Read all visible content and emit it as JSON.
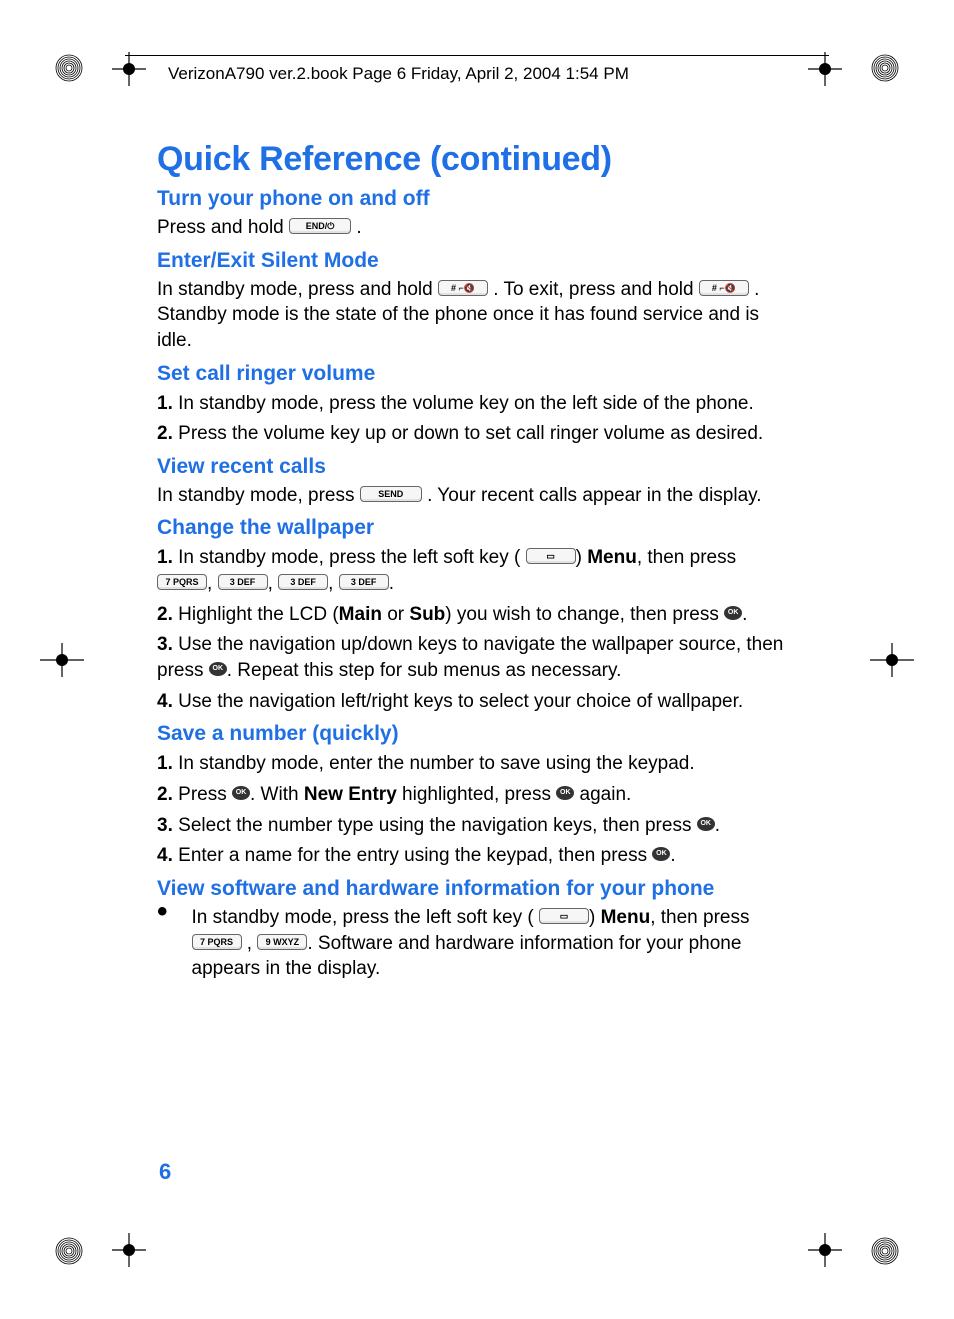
{
  "header": {
    "running_head": "VerizonA790 ver.2.book  Page 6  Friday, April 2, 2004  1:54 PM"
  },
  "page_number": "6",
  "title": "Quick Reference (continued)",
  "keys": {
    "end": "END/⏻",
    "hash": "# ⌐🔇",
    "send": "SEND",
    "softkey": "▭",
    "key7": "7 PQRS",
    "key3": "3 DEF",
    "key9": "9 WXYZ",
    "ok": "OK"
  },
  "sections": {
    "power": {
      "heading": "Turn your phone on and off",
      "body_a": "Press and hold ",
      "body_b": "."
    },
    "silent": {
      "heading": "Enter/Exit Silent Mode",
      "body_a": "In standby mode, press and hold ",
      "body_b": ". To exit, press and hold ",
      "body_c": ". Standby mode is the state of the phone once it has found service and is idle."
    },
    "ringer": {
      "heading": "Set call ringer volume",
      "step1": "In standby mode, press the volume key on the left side of the phone.",
      "step2": "Press the volume key up or down to set call ringer volume as desired."
    },
    "recent": {
      "heading": "View recent calls",
      "body_a": "In standby mode, press ",
      "body_b": ". Your recent calls appear in the display."
    },
    "wallpaper": {
      "heading": "Change the wallpaper",
      "step1_a": "In standby mode, press the left soft key (",
      "step1_b": ") ",
      "step1_menu": "Menu",
      "step1_c": ", then press ",
      "step1_d": ".",
      "step2_a": "Highlight the LCD (",
      "step2_main": "Main",
      "step2_or": " or ",
      "step2_sub": "Sub",
      "step2_b": ") you wish to change, then press ",
      "step2_c": ".",
      "step3_a": "Use the navigation up/down keys to navigate the wallpaper source, then press ",
      "step3_b": ". Repeat this step for sub menus as necessary.",
      "step4": "Use the navigation left/right keys to select your choice of wallpaper."
    },
    "save": {
      "heading": "Save a number (quickly)",
      "step1": "In standby mode, enter the number to save using the keypad.",
      "step2_a": "Press ",
      "step2_b": ". With ",
      "step2_new": "New Entry",
      "step2_c": " highlighted, press ",
      "step2_d": " again.",
      "step3_a": "Select the number type using the navigation keys, then press ",
      "step3_b": ".",
      "step4_a": "Enter a name for the entry using the keypad, then press ",
      "step4_b": "."
    },
    "info": {
      "heading": "View software and hardware information for your phone",
      "body_a": "In standby mode, press the left soft key (",
      "body_b": ") ",
      "body_menu": "Menu",
      "body_c": ", then press ",
      "body_d": " , ",
      "body_e": ". Software and hardware information for your phone appears in the display."
    }
  }
}
